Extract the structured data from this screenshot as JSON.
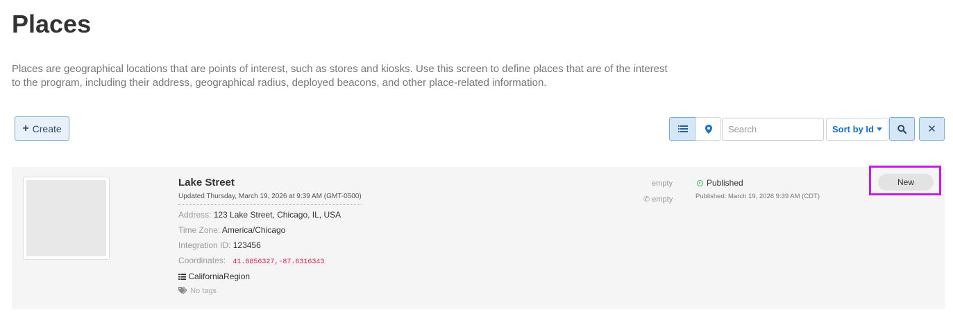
{
  "page": {
    "title": "Places",
    "description": "Places are geographical locations that are points of interest, such as stores and kiosks. Use this screen to define places that are of the interest to the program, including their address, geographical radius, deployed beacons, and other place-related information."
  },
  "toolbar": {
    "create_label": "Create",
    "search_placeholder": "Search",
    "search_value": "",
    "sort_label": "Sort by Id"
  },
  "place": {
    "name": "Lake Street",
    "updated": "Updated Thursday, March 19, 2026 at 9:39 AM (GMT-0500)",
    "address_label": "Address:",
    "address": "123 Lake Street, Chicago, IL, USA",
    "timezone_label": "Time Zone:",
    "timezone": "America/Chicago",
    "integration_label": "Integration ID:",
    "integration_id": "123456",
    "coordinates_label": "Coordinates:",
    "coordinates": "41.8856327,-87.6316343",
    "region": "CaliforniaRegion",
    "tags": "No tags",
    "email": "empty",
    "phone": "empty",
    "status": "Published",
    "published_date": "Published: March 19, 2026 9:39 AM (CDT)",
    "badge": "New"
  },
  "colors": {
    "highlight": "#c51ae8",
    "status_green": "#3bb44a",
    "accent": "#1a6fc9"
  }
}
